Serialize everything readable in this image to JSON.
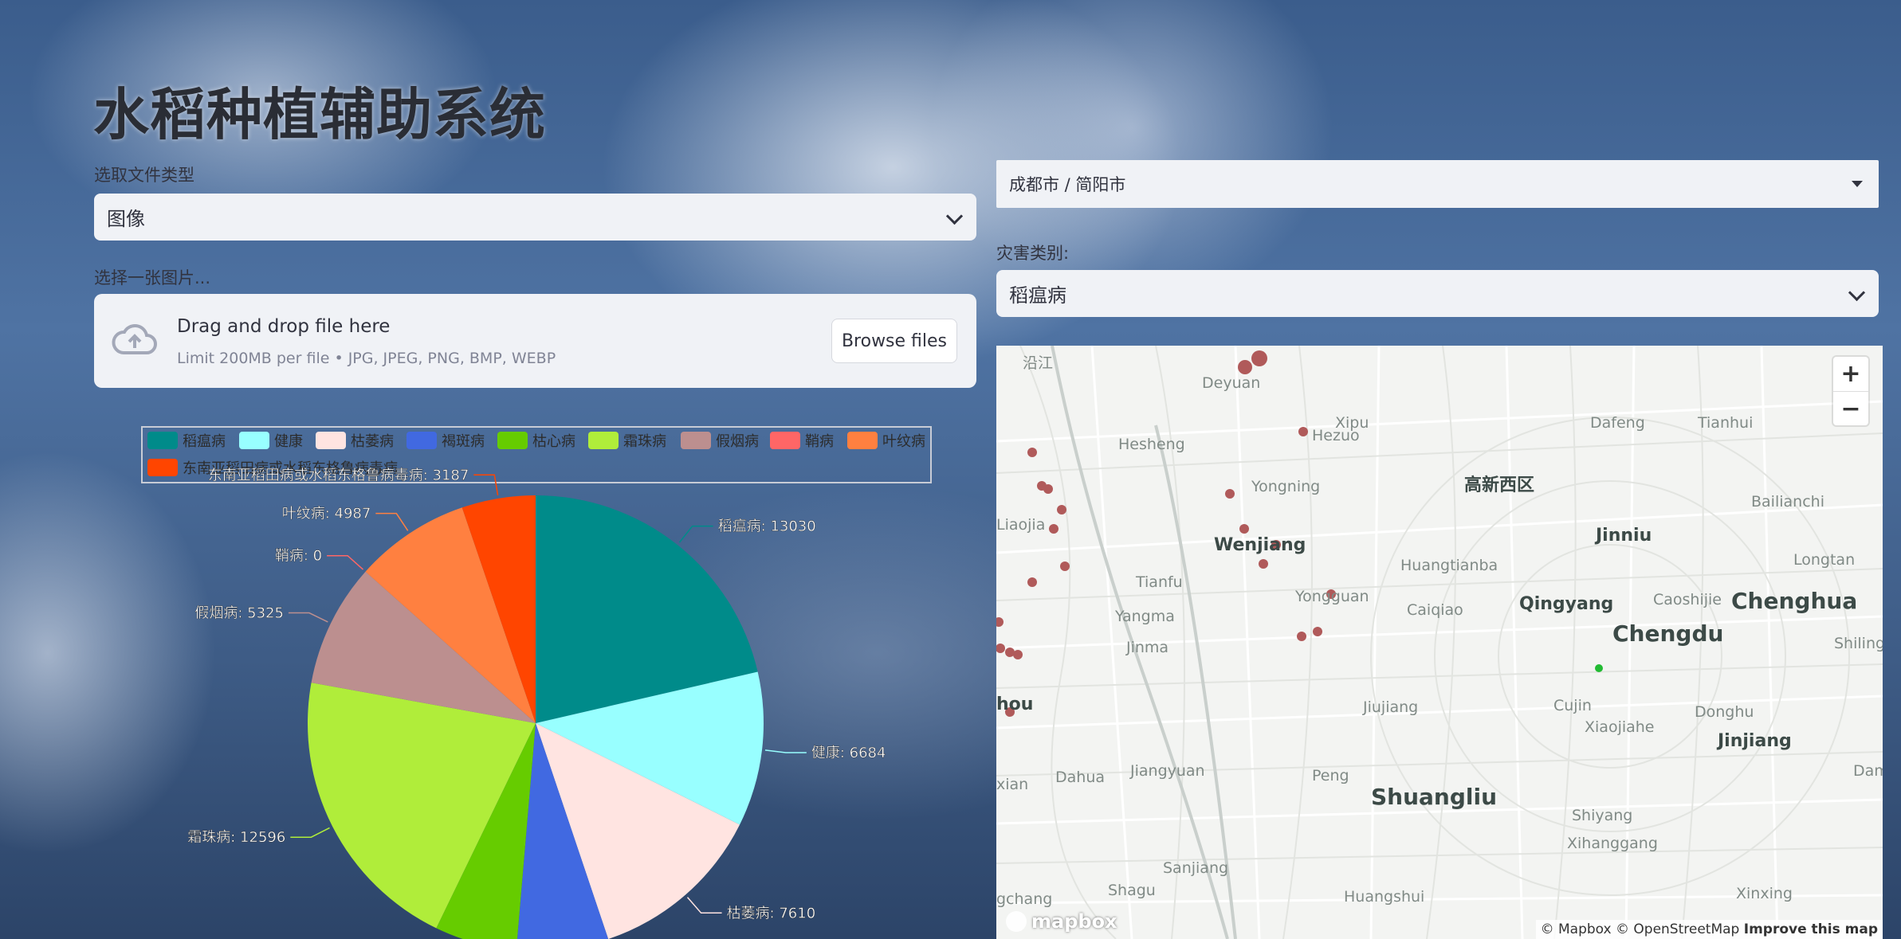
{
  "app": {
    "title": "水稻种植辅助系统"
  },
  "left": {
    "file_type_label": "选取文件类型",
    "file_type_value": "图像",
    "uploader_label": "选择一张图片...",
    "uploader": {
      "drag_text": "Drag and drop file here",
      "limit_text": "Limit 200MB per file • JPG, JPEG, PNG, BMP, WEBP",
      "browse_label": "Browse files"
    }
  },
  "right": {
    "location_value": "成都市 / 简阳市",
    "disease_label": "灾害类别:",
    "disease_value": "稻瘟病"
  },
  "chart_data": {
    "type": "pie",
    "legend_position": "top",
    "categories": [
      "稻瘟病",
      "健康",
      "枯萎病",
      "褐斑病",
      "枯心病",
      "霜珠病",
      "假烟病",
      "鞘病",
      "叶纹病",
      "东南亚稻田病或水稻东格鲁病毒病"
    ],
    "values": [
      13030,
      6684,
      7610,
      3970,
      3550,
      12596,
      5325,
      0,
      4987,
      3187
    ],
    "labeled": [
      true,
      true,
      true,
      false,
      false,
      true,
      true,
      true,
      true,
      true
    ],
    "colors": [
      "#008b8a",
      "#98ffff",
      "#ffe4e1",
      "#4169e1",
      "#66cc00",
      "#b0ed3a",
      "#bc8f8f",
      "#ff6666",
      "#ff8040",
      "#ff4500"
    ]
  },
  "map": {
    "place_labels": [
      {
        "text": "沿江",
        "cls": "s"
      },
      {
        "text": "Deyuan",
        "cls": "s"
      },
      {
        "text": "Hesheng",
        "cls": "s"
      },
      {
        "text": "Hezuo",
        "cls": "s"
      },
      {
        "text": "Xipu",
        "cls": "s"
      },
      {
        "text": "Dafeng",
        "cls": "s"
      },
      {
        "text": "Tianhui",
        "cls": "s"
      },
      {
        "text": "高新西区",
        "cls": "m"
      },
      {
        "text": "Yongning",
        "cls": "s"
      },
      {
        "text": "Bailianchi",
        "cls": "s"
      },
      {
        "text": "Liaojia",
        "cls": "s"
      },
      {
        "text": "Wenjiang",
        "cls": "m"
      },
      {
        "text": "Jinniu",
        "cls": "m"
      },
      {
        "text": "Huangtianba",
        "cls": "s"
      },
      {
        "text": "Longtan",
        "cls": "s"
      },
      {
        "text": "Tianfu",
        "cls": "s"
      },
      {
        "text": "Yongguan",
        "cls": "s"
      },
      {
        "text": "Caiqiao",
        "cls": "s"
      },
      {
        "text": "Qingyang",
        "cls": "m"
      },
      {
        "text": "Caoshijie",
        "cls": "s"
      },
      {
        "text": "Chenghua",
        "cls": "l"
      },
      {
        "text": "Yangma",
        "cls": "s"
      },
      {
        "text": "Chengdu",
        "cls": "l"
      },
      {
        "text": "Shiling",
        "cls": "s"
      },
      {
        "text": "Jinma",
        "cls": "s"
      },
      {
        "text": "hou",
        "cls": "m"
      },
      {
        "text": "Jiujiang",
        "cls": "s"
      },
      {
        "text": "Cujin",
        "cls": "s"
      },
      {
        "text": "Donghu",
        "cls": "s"
      },
      {
        "text": "Xiaojiahe",
        "cls": "s"
      },
      {
        "text": "Jinjiang",
        "cls": "m"
      },
      {
        "text": "Dahua",
        "cls": "s"
      },
      {
        "text": "Jiangyuan",
        "cls": "s"
      },
      {
        "text": "Peng",
        "cls": "s"
      },
      {
        "text": "Dam",
        "cls": "s"
      },
      {
        "text": "xian",
        "cls": "s"
      },
      {
        "text": "Shuangliu",
        "cls": "l"
      },
      {
        "text": "Shiyang",
        "cls": "s"
      },
      {
        "text": "Xihanggang",
        "cls": "s"
      },
      {
        "text": "Sanjiang",
        "cls": "s"
      },
      {
        "text": "gchang",
        "cls": "s"
      },
      {
        "text": "Shagu",
        "cls": "s"
      },
      {
        "text": "Huangshui",
        "cls": "s"
      },
      {
        "text": "Xinxing",
        "cls": "s"
      }
    ],
    "zoom_in": "+",
    "zoom_out": "−",
    "logo": "mapbox",
    "attribution": "© Mapbox © OpenStreetMap",
    "improve": "Improve this map",
    "point_color": "#b05a5a",
    "current_color": "#22bb33"
  }
}
